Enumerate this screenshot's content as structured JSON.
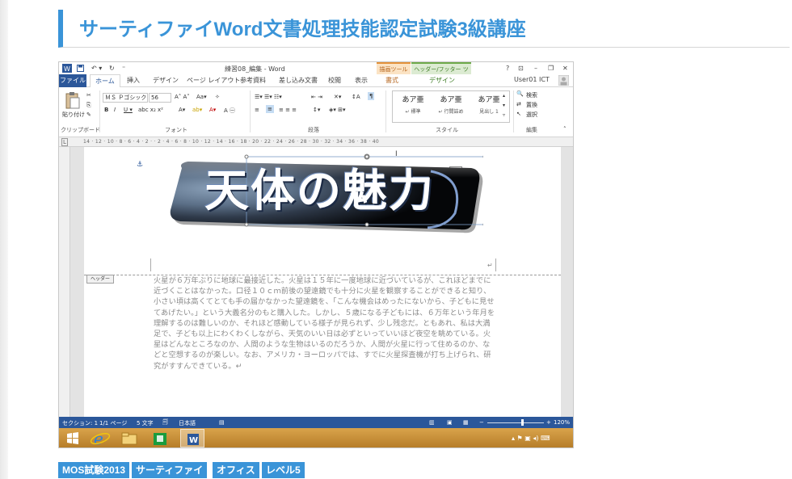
{
  "article": {
    "heading": "サーティファイWord文書処理技能認定試験3級講座"
  },
  "word": {
    "window_title": "練習08_編集 - Word",
    "ctx_tab_drawing": "描画ツール",
    "ctx_tab_header": "ヘッダー/フッター ツール",
    "help": "?",
    "user": "User01 ICT",
    "tabs": [
      "ファイル",
      "ホーム",
      "挿入",
      "デザイン",
      "ページ レイアウト",
      "参考資料",
      "差し込み文書",
      "校閲",
      "表示",
      "書式",
      "デザイン"
    ],
    "ribbon": {
      "paste": "貼り付け",
      "clipboard": "クリップボード",
      "font_name": "ＭＳ Ｐゴシック",
      "font_size": "56",
      "font_group": "フォント",
      "paragraph_group": "段落",
      "style_group": "スタイル",
      "edit_group": "編集",
      "styles": [
        {
          "preview": "あア亜",
          "name": "↵ 標準"
        },
        {
          "preview": "あア亜",
          "name": "↵ 行間詰め"
        },
        {
          "preview": "あア亜",
          "name": "見出し 1"
        }
      ],
      "find": "検索",
      "replace": "置換",
      "select": "選択"
    },
    "ruler_ticks": "14 · 12 · 10 · 8 · 6 · 4 · 2 · · 2 · 4 · 6 · 8 · 10 · 12 · 14 · 16 · 18 · 20 · 22 · 24 · 26 · 28 · 30 · 32 · 34 · 36 · 38 · 40",
    "wordart_text": "天体の魅力",
    "header_tag": "ヘッダー",
    "body_text": "火星が６万年ぶりに地球に最接近した。火星は１５年に一度地球に近づいているが、これほどまでに近づくことはなかった。口径１０ｃｍ前後の望遠鏡でも十分に火星を観察することができると知り、小さい頃は高くてとても手の届かなかった望遠鏡を、「こんな機会はめったにないから、子どもに見せてあげたい。」という大義名分のもと購入した。しかし、５歳になる子どもには、６万年という年月を理解するのは難しいのか、それほど感動している様子が見られず、少し残念だ。ともあれ、私は大満足で、子ども以上にわくわくしながら、天気のいい日は必ずといっていいほど夜空を眺めている。火星はどんなところなのか、人間のような生物はいるのだろうか、人間が火星に行って住めるのか、などと空想するのが楽しい。なお、アメリカ・ヨーロッパでは、すでに火星探査機が打ち上げられ、研究がすすんできている。↵",
    "status": {
      "section": "セクション: 1",
      "page": "1/1 ページ",
      "words": "5 文字",
      "lang": "日本語",
      "zoom": "120%",
      "zoom_level": 0.62
    }
  },
  "tags": [
    "MOS試験2013",
    "サーティファイ",
    "オフィス",
    "レベル5"
  ],
  "colors": {
    "accent": "#3a94d8",
    "word_blue": "#2b579a",
    "taskbar": "#c99239"
  }
}
